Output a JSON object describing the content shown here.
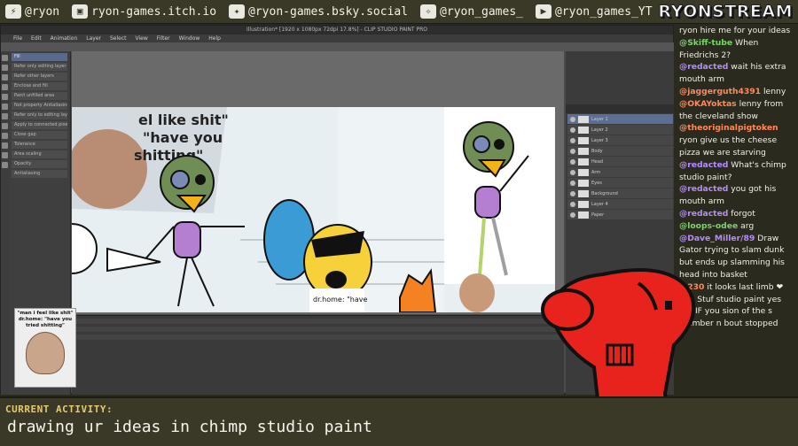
{
  "socials": [
    {
      "icon": "lightning-icon",
      "text": "@ryon"
    },
    {
      "icon": "itchio-icon",
      "text": "ryon-games.itch.io"
    },
    {
      "icon": "bluesky-icon",
      "text": "@ryon-games.bsky.social"
    },
    {
      "icon": "twitter-icon",
      "text": "@ryon_games_"
    },
    {
      "icon": "youtube-icon",
      "text": "@ryon_games_YT"
    }
  ],
  "brand": "RYONSTREAM",
  "app": {
    "title": "Illustration* [1920 x 1080px 72dpi 17.8%] - CLIP STUDIO PAINT PRO",
    "menus": [
      "File",
      "Edit",
      "Animation",
      "Layer",
      "Select",
      "View",
      "Filter",
      "Window",
      "Help"
    ],
    "subtool_items": [
      "Fill",
      "Refer only editing layer",
      "Refer other layers",
      "Enclose and fill",
      "Paint unfilled area",
      "Not property Antialiasing",
      "Refer only to editing layer",
      "Apply to connected pixels only",
      "Close gap",
      "Tolerance",
      "Area scaling",
      "Opacity",
      "Antialiasing"
    ],
    "layers": [
      "Layer 1",
      "Layer 2",
      "Layer 3",
      "Body",
      "Head",
      "Arm",
      "Eyes",
      "Background",
      "Layer 4",
      "Paper"
    ],
    "thumb_text": "\"man i feel like shit\" dr.home: \"have you tried shitting\""
  },
  "chat": [
    {
      "user": "",
      "color": "#f0f0e6",
      "text": "ryon hire me for your ideas"
    },
    {
      "user": "@Skiff-tube",
      "color": "#7bd36b",
      "text": "When Friedrichs 2?"
    },
    {
      "user": "@redacted",
      "color": "#b58cff",
      "text": "wait his extra mouth arm"
    },
    {
      "user": "@jaggerguth4391",
      "color": "#ff8a5c",
      "text": "lenny"
    },
    {
      "user": "@OKAYoktas",
      "color": "#ff8a5c",
      "text": "lenny from the cleveland show"
    },
    {
      "user": "@theoriginalpigtoken",
      "color": "#ff8a5c",
      "text": "ryon give us the cheese pizza we are starving"
    },
    {
      "user": "@redacted",
      "color": "#b58cff",
      "text": "What's chimp studio paint?"
    },
    {
      "user": "@redacted",
      "color": "#b58cff",
      "text": "you got his mouth arm"
    },
    {
      "user": "@redacted",
      "color": "#b58cff",
      "text": "forgot"
    },
    {
      "user": "@loops-odee",
      "color": "#7bd36b",
      "text": "arg"
    },
    {
      "user": "@Dave_Miller/89",
      "color": "#b58cff",
      "text": "Draw Gator trying to slam dunk but ends up slamming his head into basket"
    },
    {
      "user": "@230",
      "color": "#ff8a5c",
      "text": "it looks last limb ❤"
    },
    {
      "user": "",
      "color": "#f0f0e6",
      "text": "Clip Stuf studio paint yes"
    },
    {
      "user": "",
      "color": "#f0f0e6",
      "text": "hat IF you sion of the s"
    },
    {
      "user": "",
      "color": "#f0f0e6",
      "text": "member n bout stopped"
    }
  ],
  "activity": {
    "label": "CURRENT ACTIVITY:",
    "text": "drawing ur ideas in chimp studio paint"
  }
}
